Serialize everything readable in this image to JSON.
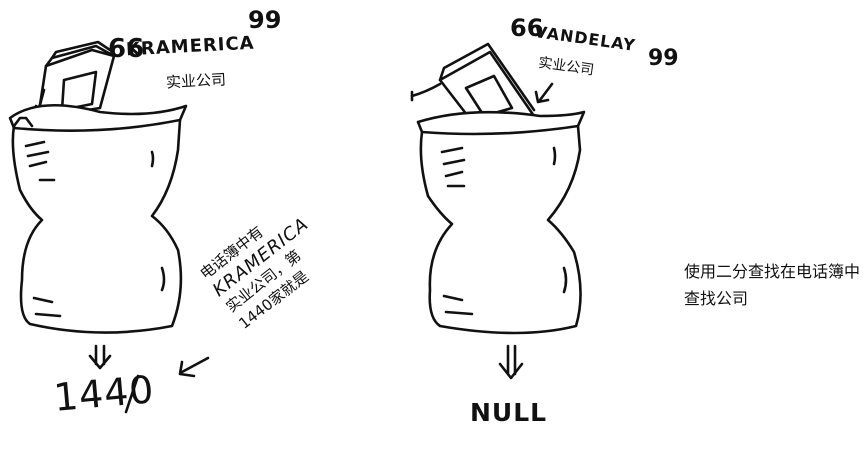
{
  "left_panel": {
    "open_quote": "66",
    "close_quote": "99",
    "company_name": "KRAMERICA",
    "company_subtitle": "实业公司",
    "result": "1440",
    "note_lines": [
      "电话簿中有",
      "KRAMERICA",
      "实业公司，第",
      "1440家就是"
    ]
  },
  "right_panel": {
    "open_quote": "66",
    "close_quote": "99",
    "company_name": "VANDELAY",
    "company_subtitle": "实业公司",
    "result": "NULL"
  },
  "caption": "使用二分查找在电话簿中查找公司"
}
